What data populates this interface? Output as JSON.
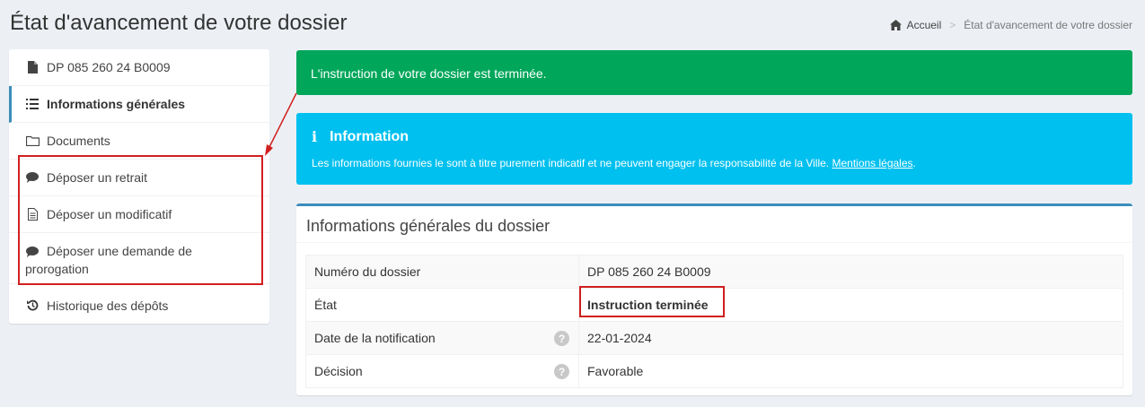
{
  "page": {
    "title": "État d'avancement de votre dossier"
  },
  "breadcrumb": {
    "home": "Accueil",
    "current": "État d'avancement de votre dossier"
  },
  "sidebar": {
    "items": [
      {
        "label": "DP 085 260 24 B0009",
        "icon": "file-icon"
      },
      {
        "label": "Informations générales",
        "icon": "list-icon",
        "active": true
      },
      {
        "label": "Documents",
        "icon": "folder-icon"
      },
      {
        "label": "Déposer un retrait",
        "icon": "comment-icon"
      },
      {
        "label": "Déposer un modificatif",
        "icon": "document-icon"
      },
      {
        "label": "Déposer une demande de prorogation",
        "icon": "comment-icon"
      },
      {
        "label": "Historique des dépôts",
        "icon": "history-icon"
      }
    ]
  },
  "alerts": {
    "success": "L'instruction de votre dossier est terminée.",
    "info_title": "Information",
    "info_text": "Les informations fournies le sont à titre purement indicatif et ne peuvent engager la responsabilité de la Ville.",
    "info_link": "Mentions légales",
    "info_after": "."
  },
  "box": {
    "title": "Informations générales du dossier",
    "rows": [
      {
        "label": "Numéro du dossier",
        "value": "DP 085 260 24 B0009"
      },
      {
        "label": "État",
        "value": "Instruction terminée"
      },
      {
        "label": "Date de la notification",
        "value": "22-01-2024",
        "help": "?"
      },
      {
        "label": "Décision",
        "value": "Favorable",
        "help": "?"
      }
    ]
  },
  "colors": {
    "success": "#00a65a",
    "info": "#00c0ef",
    "primary": "#3c8dbc",
    "annotation": "#d11f1f"
  }
}
